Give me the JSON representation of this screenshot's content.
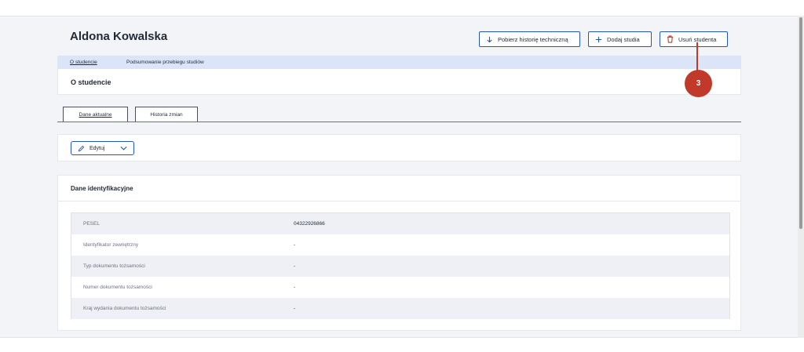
{
  "student": {
    "name": "Aldona Kowalska"
  },
  "toolbar": {
    "history_label": "Pobierz historię techniczną",
    "add_label": "Dodaj studia",
    "remove_label": "Usuń studenta"
  },
  "tabs": [
    {
      "label": "O studencie",
      "active": true
    },
    {
      "label": "Podsumowanie przebiegu studiów",
      "active": false
    }
  ],
  "section": {
    "title": "O studencie"
  },
  "callout": {
    "step": "3",
    "color": "#c0392b"
  },
  "subtabs": [
    {
      "label": "Dane aktualne",
      "active": true
    },
    {
      "label": "Historia zmian",
      "active": false
    }
  ],
  "edit": {
    "label": "Edytuj"
  },
  "identification": {
    "title": "Dane identyfikacyjne",
    "rows": [
      {
        "label": "PESEL",
        "value": "04322926866"
      },
      {
        "label": "Identyfikator zewnętrzny",
        "value": "-"
      },
      {
        "label": "Typ dokumentu tożsamości",
        "value": "-"
      },
      {
        "label": "Numer dokumentu tożsamości",
        "value": "-"
      },
      {
        "label": "Kraj wydania dokumentu tożsamości",
        "value": "-"
      }
    ]
  },
  "colors": {
    "accent": "#2456b5",
    "danger": "#c0392b",
    "tabbar": "#dce4f8",
    "background": "#f3f4f7"
  },
  "icons": {
    "history": "arrow-down-icon",
    "add": "plus-icon",
    "remove": "trash-icon",
    "edit": "pencil-icon",
    "dropdown": "chevron-down-icon"
  }
}
